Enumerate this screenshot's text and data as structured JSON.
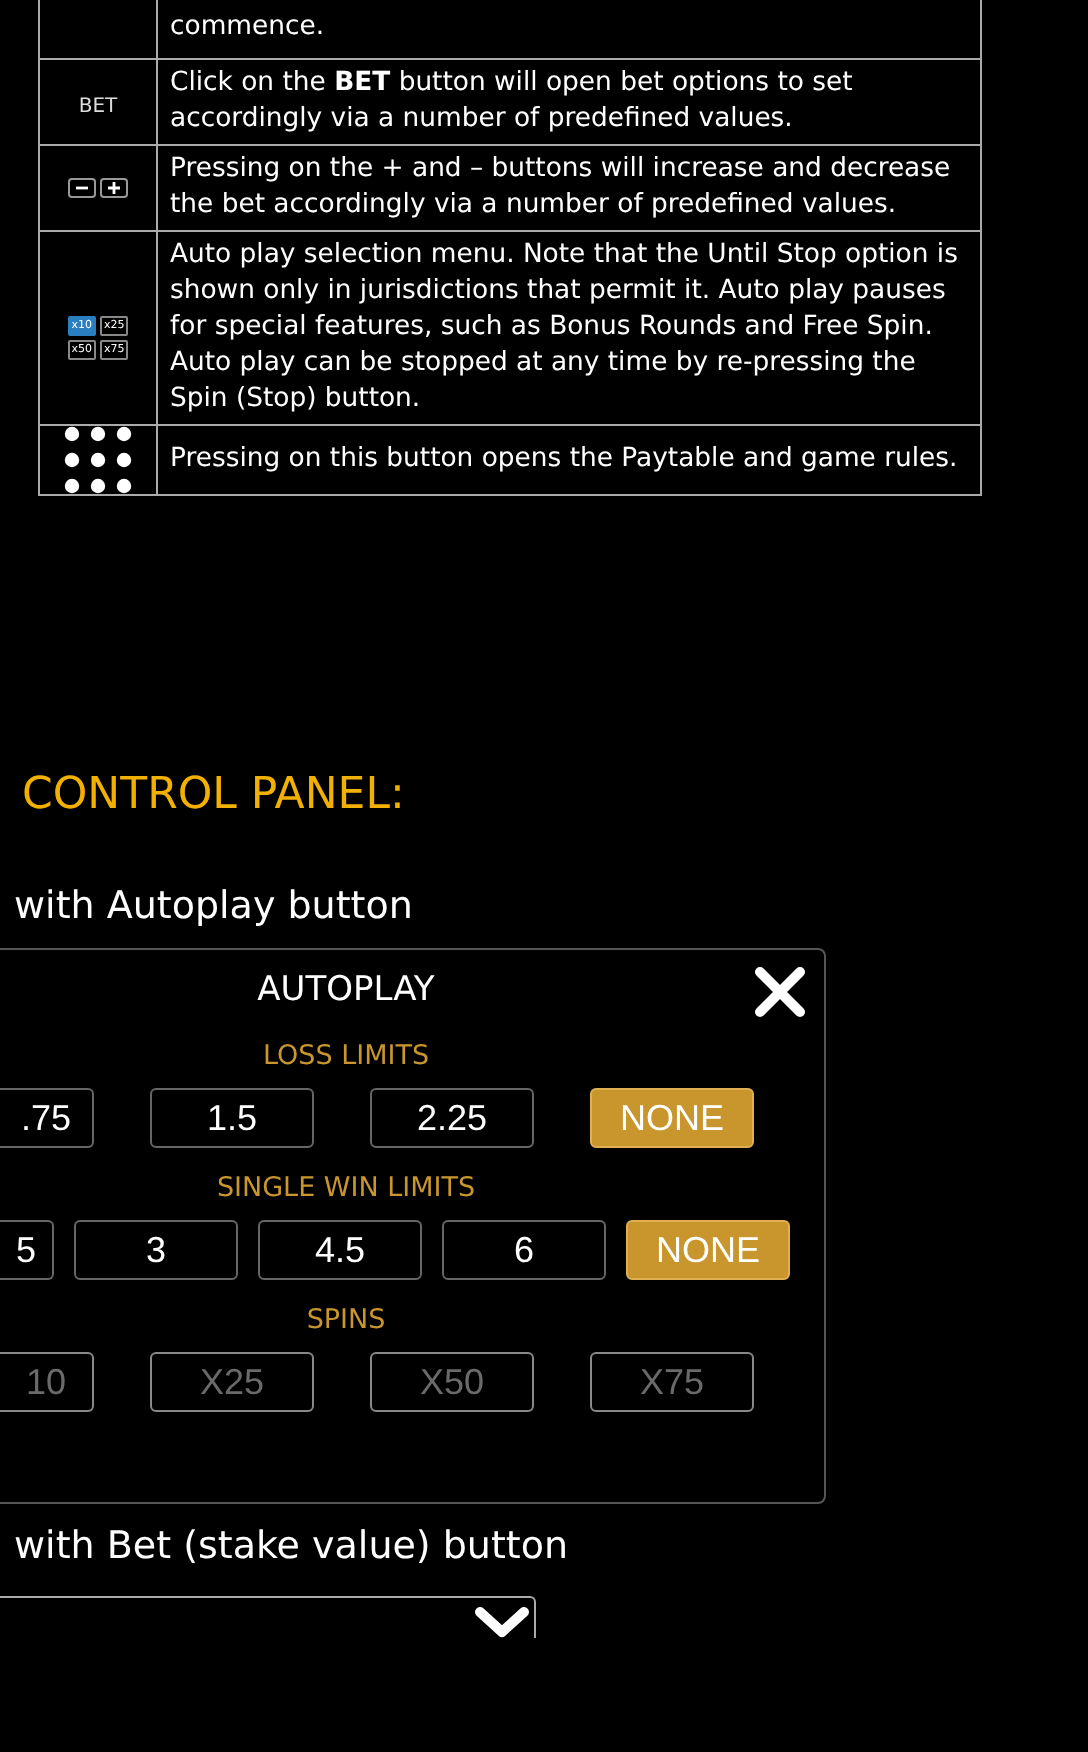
{
  "rules_table": {
    "rows": [
      {
        "kind": "continued",
        "text": "commence."
      },
      {
        "kind": "bet",
        "icon_text": "BET",
        "text": "Click on the **BET** button will open bet options to set accordingly via a number of predefined values."
      },
      {
        "kind": "plus_minus",
        "text": "Pressing on the + and – buttons will increase and decrease the bet accordingly via a number of predefined values."
      },
      {
        "kind": "autoplay",
        "icon_buttons": [
          {
            "label": "x10",
            "selected": true
          },
          {
            "label": "x25",
            "selected": false
          },
          {
            "label": "x50",
            "selected": false
          },
          {
            "label": "x75",
            "selected": false
          }
        ],
        "text": "Auto play selection menu. Note that the Until Stop option is shown only in jurisdictions that permit it. Auto play pauses for special features, such as Bonus Rounds and Free Spin. Auto play can be stopped at any time by re-pressing the Spin (Stop) button."
      },
      {
        "kind": "menu",
        "text": "Pressing on this button opens the Paytable and game rules."
      }
    ]
  },
  "heading": "CONTROL PANEL:",
  "autoplay_caption": "with Autoplay button",
  "autoplay_dialog": {
    "title": "AUTOPLAY",
    "sections": [
      {
        "label": "LOSS LIMITS",
        "options": [
          {
            "label": ".75",
            "partial": true,
            "selected": false,
            "disabled": false
          },
          {
            "label": "1.5",
            "partial": false,
            "selected": false,
            "disabled": false
          },
          {
            "label": "2.25",
            "partial": false,
            "selected": false,
            "disabled": false
          },
          {
            "label": "NONE",
            "partial": false,
            "selected": true,
            "disabled": false
          }
        ]
      },
      {
        "label": "SINGLE WIN LIMITS",
        "options": [
          {
            "label": "5",
            "partial": true,
            "selected": false,
            "disabled": false
          },
          {
            "label": "3",
            "partial": false,
            "selected": false,
            "disabled": false
          },
          {
            "label": "4.5",
            "partial": false,
            "selected": false,
            "disabled": false
          },
          {
            "label": "6",
            "partial": false,
            "selected": false,
            "disabled": false
          },
          {
            "label": "NONE",
            "partial": false,
            "selected": true,
            "disabled": false
          }
        ]
      },
      {
        "label": "SPINS",
        "options": [
          {
            "label": "10",
            "partial": true,
            "selected": false,
            "disabled": true
          },
          {
            "label": "X25",
            "partial": false,
            "selected": false,
            "disabled": true
          },
          {
            "label": "X50",
            "partial": false,
            "selected": false,
            "disabled": true
          },
          {
            "label": "X75",
            "partial": false,
            "selected": false,
            "disabled": true
          }
        ]
      }
    ]
  },
  "bet_caption": "with Bet (stake value) button"
}
